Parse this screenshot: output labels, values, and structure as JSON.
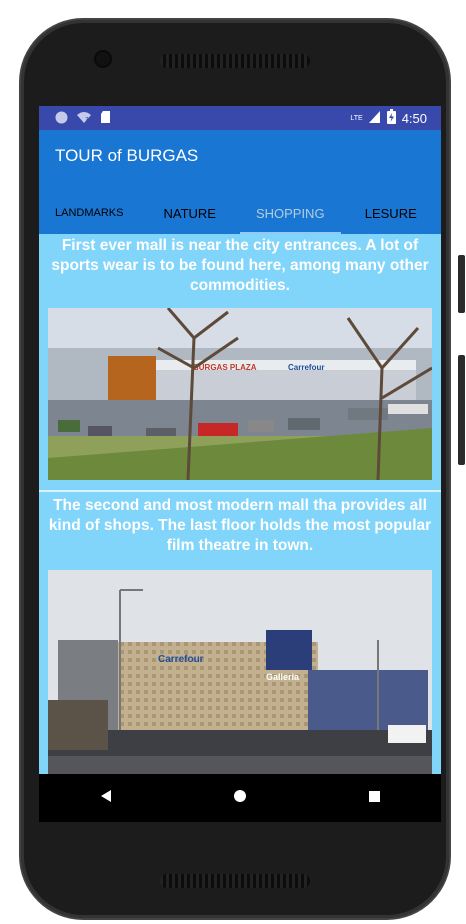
{
  "statusbar": {
    "left_icons": [
      "circle-icon",
      "wifi-icon",
      "sd-card-icon"
    ],
    "network_label": "LTE",
    "time": "4:50"
  },
  "app": {
    "title": "TOUR of BURGAS"
  },
  "tabs": [
    {
      "label": "LANDMARKS",
      "active": false
    },
    {
      "label": "NATURE",
      "active": false
    },
    {
      "label": "SHOPPING",
      "active": true
    },
    {
      "label": "LESURE",
      "active": false
    }
  ],
  "items": [
    {
      "text": "First ever mall is near the city entrances. A lot of sports wear is to be found here, among many other commodities.",
      "image_sign_1": "BURGAS PLAZA",
      "image_sign_2": "Carrefour"
    },
    {
      "text": "The second and most modern mall tha provides all kind of shops. The last floor holds the most popular film theatre in town.",
      "image_sign_1": "Carrefour",
      "image_sign_2": "Galleria"
    }
  ],
  "navbar": {
    "back_icon": "back-triangle-icon",
    "home_icon": "home-circle-icon",
    "recents_icon": "recents-square-icon"
  },
  "colors": {
    "statusbar": "#3949ab",
    "appbar": "#1976d2",
    "content_bg": "#81d4fa"
  }
}
